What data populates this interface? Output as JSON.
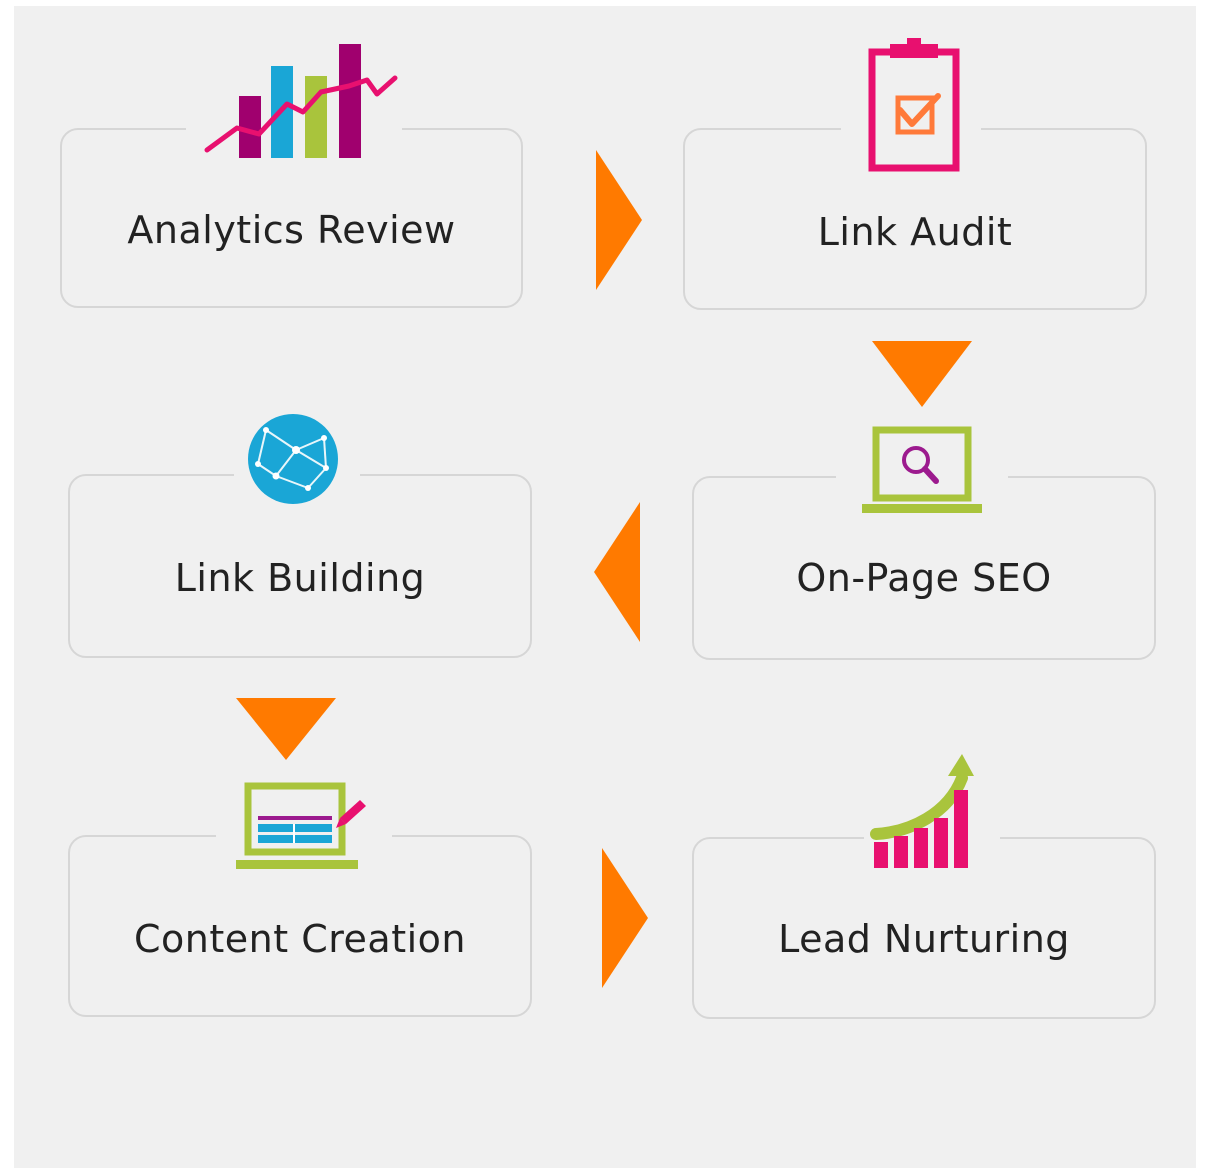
{
  "steps": [
    {
      "label": "Analytics Review",
      "icon": "bar-chart-icon"
    },
    {
      "label": "Link Audit",
      "icon": "clipboard-check-icon"
    },
    {
      "label": "On-Page SEO",
      "icon": "laptop-search-icon"
    },
    {
      "label": "Link Building",
      "icon": "globe-network-icon"
    },
    {
      "label": "Content Creation",
      "icon": "laptop-edit-icon"
    },
    {
      "label": "Lead Nurturing",
      "icon": "growth-chart-icon"
    }
  ],
  "colors": {
    "arrow": "#ff7a00",
    "pink": "#e8106f",
    "magenta": "#a0006e",
    "blue": "#1aa6d6",
    "green": "#a9c43c",
    "purple": "#9c1a8e"
  }
}
